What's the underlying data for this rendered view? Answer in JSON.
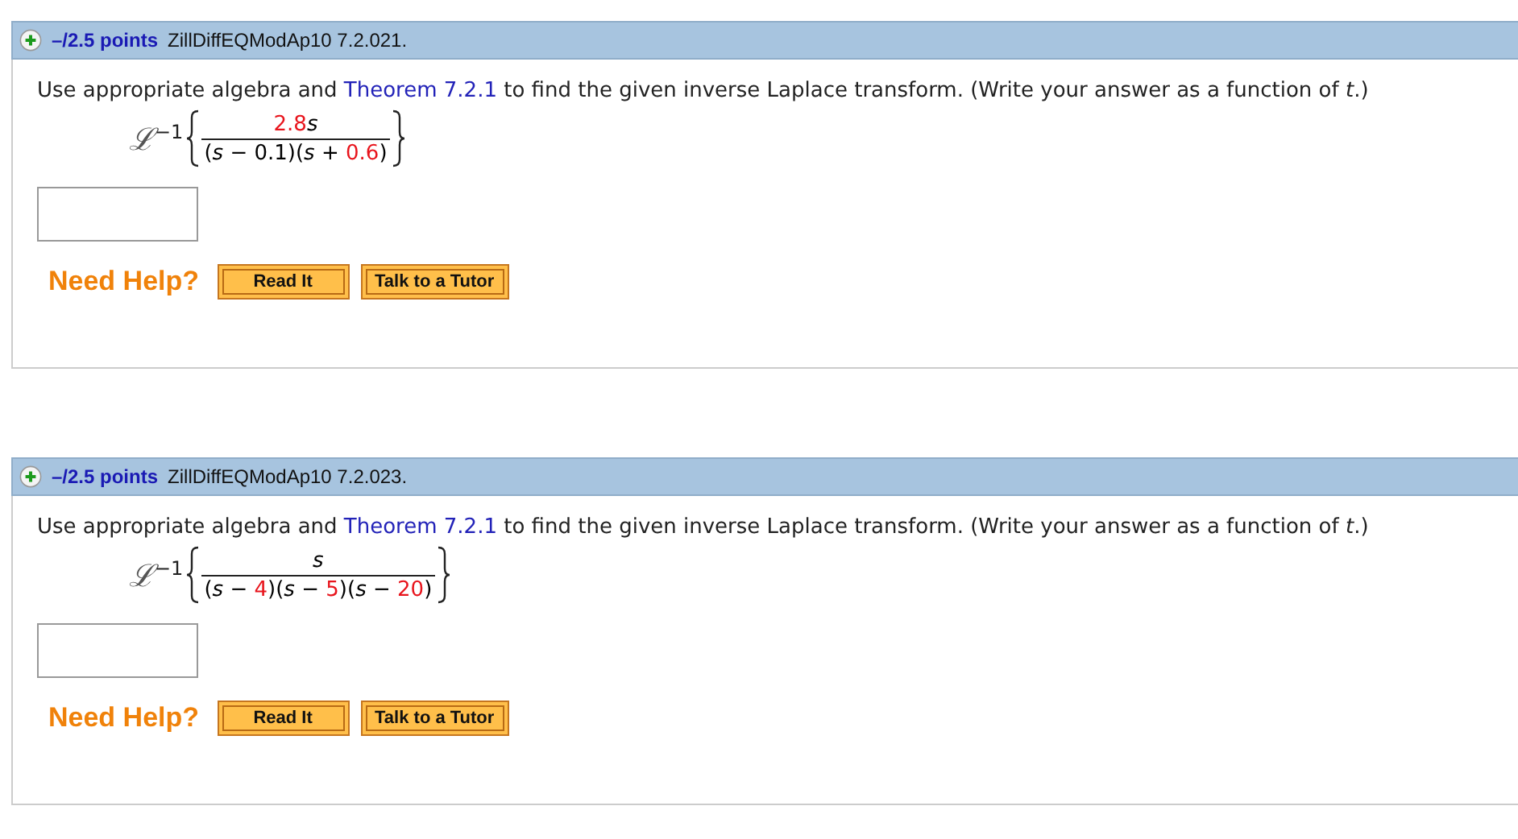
{
  "questions": [
    {
      "points": "–/2.5 points",
      "reference": "ZillDiffEQModAp10 7.2.021.",
      "prompt_before": "Use appropriate algebra and ",
      "link": "Theorem 7.2.1",
      "prompt_after": " to find the given inverse Laplace transform. (Write your answer as a function of *t*.)",
      "operator": "ℒ",
      "exponent": "−1",
      "numerator": [
        {
          "text": "2.8",
          "highlighted": true
        },
        {
          "text": "*s*",
          "highlighted": false
        }
      ],
      "denominator": [
        {
          "text": "(*s* − 0.1)(*s* + ",
          "highlighted": false
        },
        {
          "text": "0.6",
          "highlighted": true
        },
        {
          "text": ")",
          "highlighted": false
        }
      ],
      "help_label": "Need Help?",
      "buttons": [
        "Read It",
        "Talk to a Tutor"
      ]
    },
    {
      "points": "–/2.5 points",
      "reference": "ZillDiffEQModAp10 7.2.023.",
      "prompt_before": "Use appropriate algebra and ",
      "link": "Theorem 7.2.1",
      "prompt_after": " to find the given inverse Laplace transform. (Write your answer as a function of *t*.)",
      "operator": "ℒ",
      "exponent": "−1",
      "numerator": [
        {
          "text": "*s*",
          "highlighted": false
        }
      ],
      "denominator": [
        {
          "text": "(*s* − ",
          "highlighted": false
        },
        {
          "text": "4",
          "highlighted": true
        },
        {
          "text": ")(*s* − ",
          "highlighted": false
        },
        {
          "text": "5",
          "highlighted": true
        },
        {
          "text": ")(*s* − ",
          "highlighted": false
        },
        {
          "text": "20",
          "highlighted": true
        },
        {
          "text": ")",
          "highlighted": false
        }
      ],
      "help_label": "Need Help?",
      "buttons": [
        "Read It",
        "Talk to a Tutor"
      ]
    }
  ]
}
